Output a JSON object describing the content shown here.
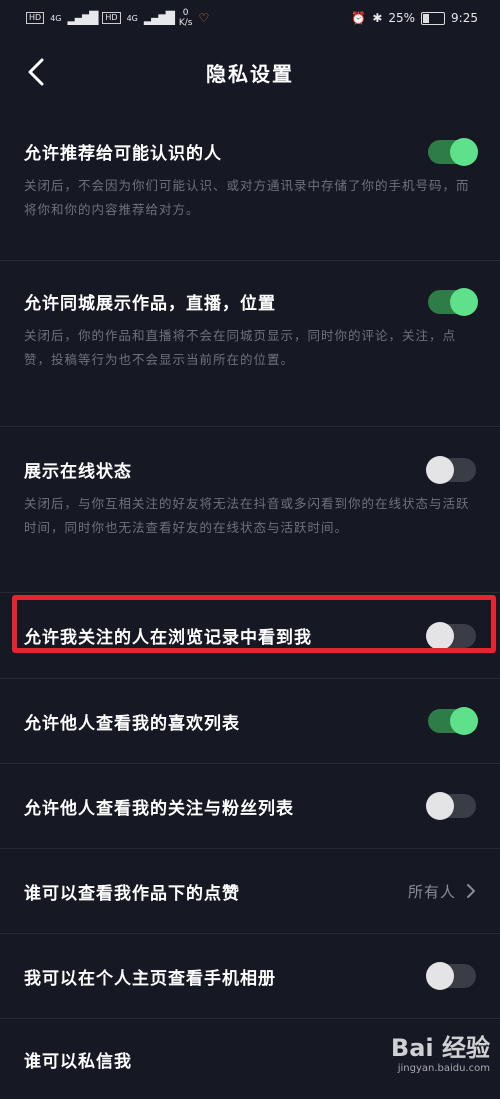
{
  "status_bar": {
    "hd1": "HD",
    "hd2": "HD",
    "signal1": "4G",
    "signal2": "4G",
    "speed_value": "0",
    "speed_unit": "K/s",
    "battery": "25%",
    "time": "9:25"
  },
  "header": {
    "title": "隐私设置"
  },
  "items": [
    {
      "label": "允许推荐给可能认识的人",
      "toggle": "on",
      "desc": "关闭后，不会因为你们可能认识、或对方通讯录中存储了你的手机号码，而将你和你的内容推荐给对方。"
    },
    {
      "label": "允许同城展示作品，直播，位置",
      "toggle": "on",
      "desc": "关闭后，你的作品和直播将不会在同城页显示，同时你的评论，关注，点赞，投稿等行为也不会显示当前所在的位置。"
    },
    {
      "label": "展示在线状态",
      "toggle": "off",
      "desc": "关闭后，与你互相关注的好友将无法在抖音或多闪看到你的在线状态与活跃时间，同时你也无法查看好友的在线状态与活跃时间。"
    },
    {
      "label": "允许我关注的人在浏览记录中看到我",
      "toggle": "off"
    },
    {
      "label": "允许他人查看我的喜欢列表",
      "toggle": "on"
    },
    {
      "label": "允许他人查看我的关注与粉丝列表",
      "toggle": "off"
    },
    {
      "label": "谁可以查看我作品下的点赞",
      "value": "所有人"
    },
    {
      "label": "我可以在个人主页查看手机相册",
      "toggle": "off"
    },
    {
      "label": "谁可以私信我"
    }
  ],
  "watermark": {
    "logo": "Bai 经验",
    "url": "jingyan.baidu.com"
  },
  "colors": {
    "background": "#161823",
    "toggle_on": "#5fe08a",
    "highlight": "#e5252f"
  }
}
